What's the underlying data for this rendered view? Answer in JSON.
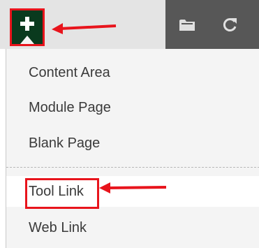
{
  "toolbar": {
    "add_icon": "plus-icon",
    "folder_icon": "folder-icon",
    "refresh_icon": "refresh-icon"
  },
  "menu": {
    "items": [
      {
        "label": "Content Area"
      },
      {
        "label": "Module Page"
      },
      {
        "label": "Blank Page"
      },
      {
        "label": "Tool Link"
      },
      {
        "label": "Web Link"
      }
    ]
  },
  "colors": {
    "annotation_red": "#e8141c",
    "add_button_bg": "#0a3a1e",
    "toolbar_dark": "#575757",
    "toolbar_light": "#e4e4e4"
  }
}
